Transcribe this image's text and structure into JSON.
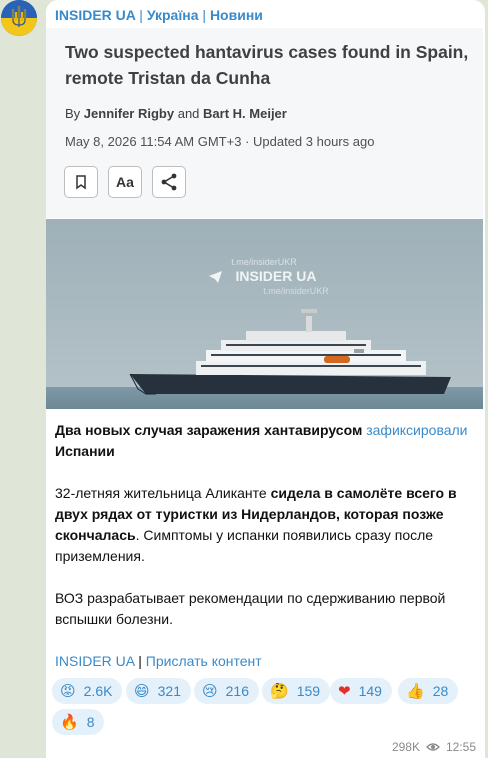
{
  "channel": {
    "name": "INSIDER UA",
    "sep": "|",
    "cat1": "Україна",
    "cat2": "Новини"
  },
  "article": {
    "title": "Two suspected hantavirus cases found in Spain, remote Tristan da Cunha",
    "by_prefix": "By",
    "author1": "Jennifer Rigby",
    "and": "and",
    "author2": "Bart H. Meijer",
    "date": "May 8, 2026 11:54 AM GMT+3",
    "updated": "· Updated 3 hours ago",
    "font_button": "Aa"
  },
  "photo": {
    "watermark_top": "t.me/insiderUKR",
    "watermark_main": "INSIDER UA",
    "watermark_bottom": "t.me/insiderUKR"
  },
  "post": {
    "p1_bold": "Два новых случая заражения хантавирусом",
    "p1_link": "зафиксировали",
    "p1_tail": "Испании",
    "p2_start": "32-летняя жительница Аликанте",
    "p2_bold": "сидела в самолёте всего в двух рядах от туристки из Нидерландов, которая позже скончалась",
    "p2_end": ". Симптомы у испанки появились сразу после приземления.",
    "p3": "ВОЗ разрабатывает рекомендации по сдерживанию первой вспышки болезни.",
    "footer_link1": "INSIDER UA",
    "footer_sep": "|",
    "footer_link2": "Прислать контент"
  },
  "reactions": [
    {
      "icon": "angry-face-icon",
      "emoji": "😡",
      "count": "2.6K"
    },
    {
      "icon": "grinning-face-icon",
      "emoji": "😄",
      "count": "321"
    },
    {
      "icon": "crying-face-icon",
      "emoji": "😢",
      "count": "216"
    },
    {
      "icon": "thinking-face-icon",
      "emoji": "🤔",
      "count": "159"
    },
    {
      "icon": "red-heart-icon",
      "emoji": "❤",
      "count": "149"
    },
    {
      "icon": "thumbs-up-icon",
      "emoji": "👍",
      "count": "28"
    },
    {
      "icon": "fire-icon",
      "emoji": "🔥",
      "count": "8"
    }
  ],
  "meta": {
    "views": "298K",
    "time": "12:55"
  },
  "colors": {
    "link": "#3a8ac9",
    "reaction_bg": "#e4f1fa",
    "chat_bg": "#dfe6d7"
  }
}
